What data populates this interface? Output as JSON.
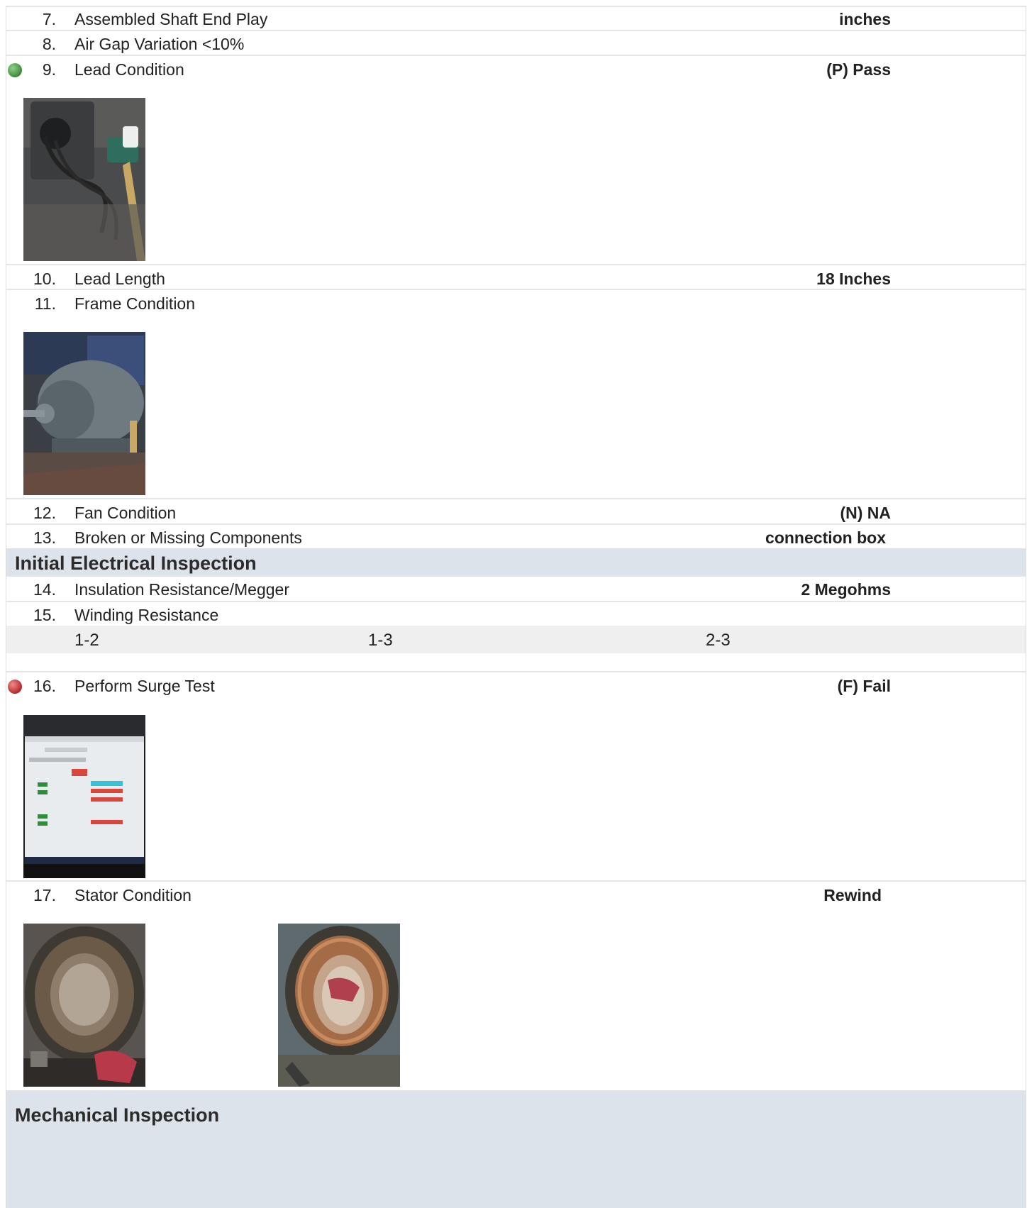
{
  "items": {
    "i7": {
      "num": "7.",
      "label": "Assembled Shaft End Play",
      "value": "inches"
    },
    "i8": {
      "num": "8.",
      "label": "Air Gap Variation <10%"
    },
    "i9": {
      "num": "9.",
      "label": "Lead Condition",
      "value": "(P) Pass",
      "status_color": "#4a9a44"
    },
    "i10": {
      "num": "10.",
      "label": "Lead Length",
      "value": "18 Inches"
    },
    "i11": {
      "num": "11.",
      "label": "Frame Condition"
    },
    "i12": {
      "num": "12.",
      "label": "Fan Condition",
      "value": "(N) NA"
    },
    "i13": {
      "num": "13.",
      "label": "Broken or Missing Components",
      "value": "connection box"
    },
    "i14": {
      "num": "14.",
      "label": "Insulation Resistance/Megger",
      "value": "2 Megohms"
    },
    "i15": {
      "num": "15.",
      "label": "Winding Resistance",
      "sub": [
        "1-2",
        "1-3",
        "2-3"
      ]
    },
    "i16": {
      "num": "16.",
      "label": "Perform Surge Test",
      "value": "(F) Fail",
      "status_color": "#c03a3a"
    },
    "i17": {
      "num": "17.",
      "label": "Stator Condition",
      "value": "Rewind"
    }
  },
  "sections": {
    "electrical": "Initial Electrical Inspection",
    "mechanical": "Mechanical Inspection"
  },
  "colors": {
    "section_bg": "#dde3ea",
    "row_border": "#e2e6ea",
    "subrow_bg": "#efefef"
  }
}
